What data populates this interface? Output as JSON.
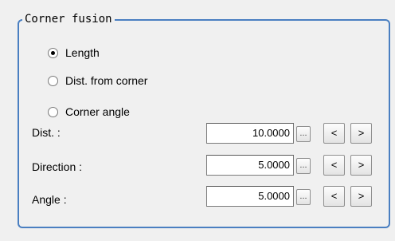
{
  "group": {
    "title": "Corner fusion"
  },
  "radios": [
    {
      "label": "Length",
      "checked": true
    },
    {
      "label": "Dist. from corner",
      "checked": false
    },
    {
      "label": "Corner angle",
      "checked": false
    }
  ],
  "fields": [
    {
      "label": "Dist. :",
      "value": "10.0000"
    },
    {
      "label": "Direction :",
      "value": "5.0000"
    },
    {
      "label": "Angle :",
      "value": "5.0000"
    }
  ],
  "buttons": {
    "dots": "...",
    "decrement": "<",
    "increment": ">"
  }
}
